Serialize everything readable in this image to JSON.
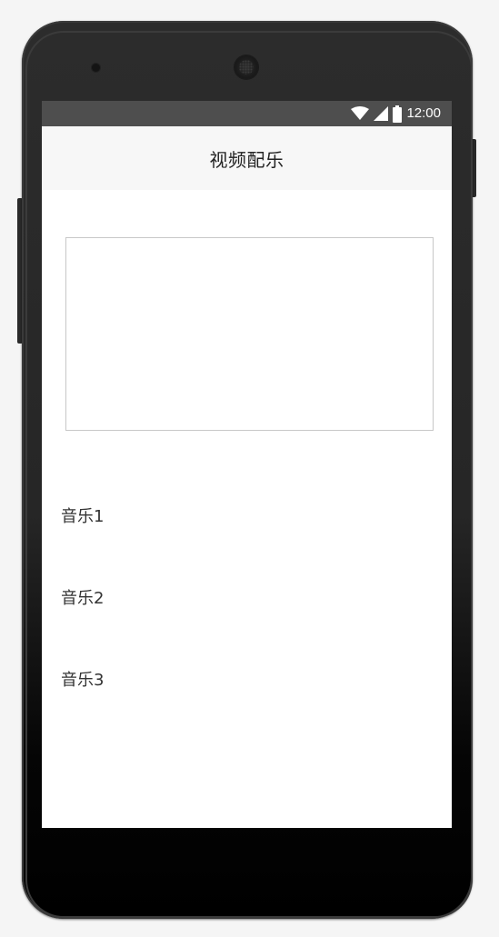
{
  "status_bar": {
    "time": "12:00",
    "icons": [
      "wifi-icon",
      "signal-icon",
      "battery-icon"
    ],
    "background": "#4e4e4e"
  },
  "app_bar": {
    "title": "视频配乐"
  },
  "video_area": {
    "border_color": "#c8c8c8"
  },
  "music_list": [
    {
      "label": "音乐1"
    },
    {
      "label": "音乐2"
    },
    {
      "label": "音乐3"
    }
  ]
}
